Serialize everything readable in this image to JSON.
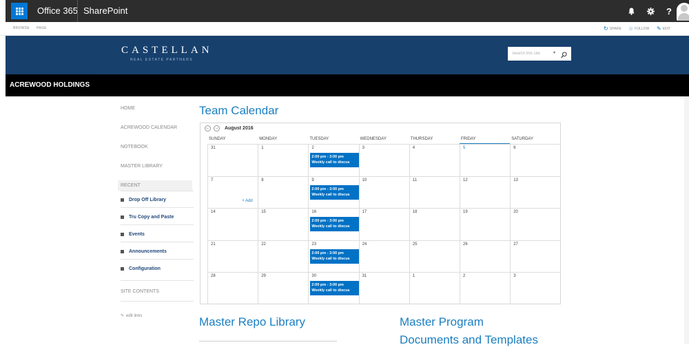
{
  "suite_bar": {
    "app_name": "Office 365",
    "product_name": "SharePoint",
    "help_label": "?"
  },
  "ribbon": {
    "tabs": [
      "BROWSE",
      "PAGE"
    ],
    "share_label": "SHARE",
    "follow_label": "FOLLOW",
    "edit_label": "EDIT"
  },
  "banner": {
    "logo_main": "CASTELLAN",
    "logo_sub": "REAL ESTATE PARTNERS",
    "search_placeholder": "Search this site"
  },
  "site": {
    "title": "ACREWOOD HOLDINGS"
  },
  "left_nav": {
    "items": [
      "HOME",
      "ACREWOOD CALENDAR",
      "NOTEBOOK",
      "MASTER LIBRARY",
      "RECENT"
    ],
    "recent_items": [
      "Drop Off Library",
      "Tru Copy and Paste",
      "Events",
      "Announcements",
      "Configuration"
    ],
    "site_contents": "SITE CONTENTS",
    "edit_links": "edit links"
  },
  "calendar": {
    "title": "Team Calendar",
    "month": "August 2016",
    "day_names": [
      "SUNDAY",
      "MONDAY",
      "TUESDAY",
      "WEDNESDAY",
      "THURSDAY",
      "FRIDAY",
      "SATURDAY"
    ],
    "weeks": [
      [
        "31",
        "1",
        "2",
        "3",
        "4",
        "5",
        "6"
      ],
      [
        "7",
        "8",
        "9",
        "10",
        "11",
        "12",
        "13"
      ],
      [
        "14",
        "15",
        "16",
        "17",
        "18",
        "19",
        "20"
      ],
      [
        "21",
        "22",
        "23",
        "24",
        "25",
        "26",
        "27"
      ],
      [
        "28",
        "29",
        "30",
        "31",
        "1",
        "2",
        "3"
      ]
    ],
    "event_time": "2:00 pm - 3:00 pm",
    "event_title": "Weekly call to discus",
    "add_label": "+ Add"
  },
  "sections": {
    "repo_library": "Master Repo Library",
    "program_docs_line1": "Master Program",
    "program_docs_line2": "Documents and Templates"
  }
}
